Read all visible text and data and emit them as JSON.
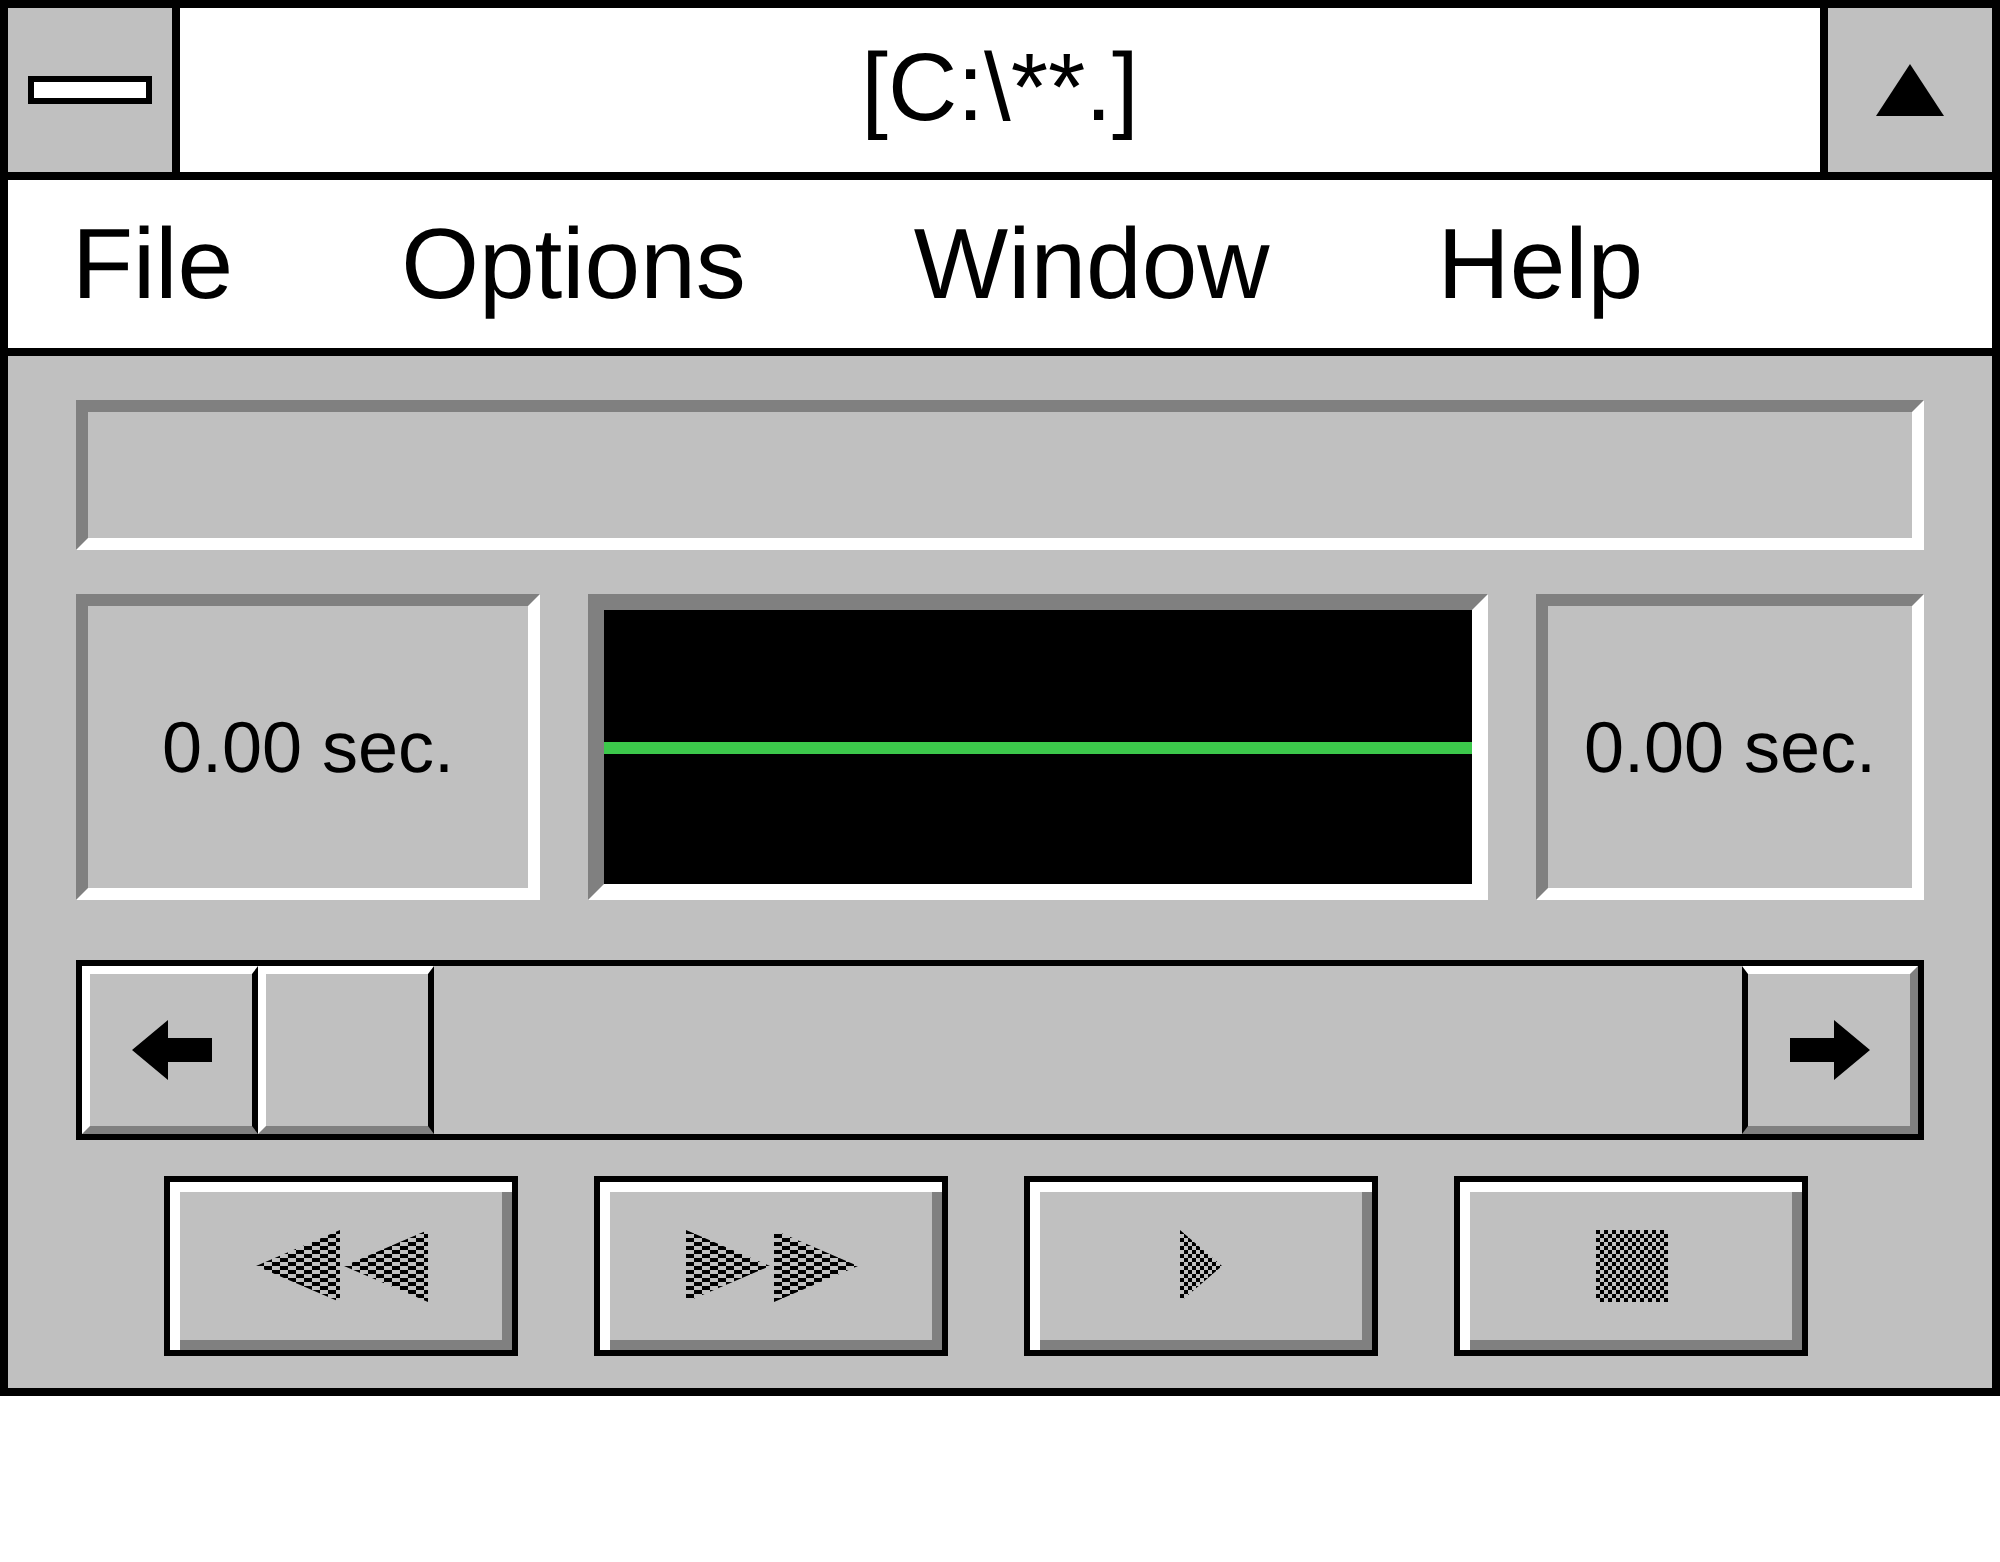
{
  "window": {
    "title": "[C:\\**.]"
  },
  "menu": [
    "File",
    "Options",
    "Window",
    "Help"
  ],
  "position": "0.00 sec.",
  "length": "0.00 sec.",
  "controls": [
    {
      "kind": "rewind",
      "disabled": true
    },
    {
      "kind": "fast_forward",
      "disabled": true
    },
    {
      "kind": "play",
      "disabled": true
    },
    {
      "kind": "stop",
      "disabled": true
    }
  ]
}
